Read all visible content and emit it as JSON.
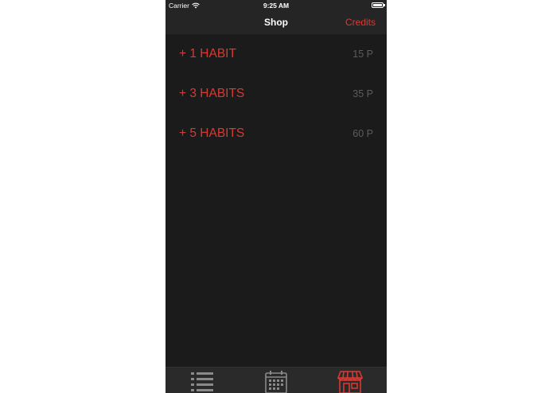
{
  "status_bar": {
    "carrier": "Carrier",
    "time": "9:25 AM",
    "battery_level": 1.0
  },
  "nav_bar": {
    "title": "Shop",
    "right_button": "Credits"
  },
  "shop_items": [
    {
      "label": "+ 1 HABIT",
      "price": "15 P"
    },
    {
      "label": "+ 3 HABITS",
      "price": "35 P"
    },
    {
      "label": "+ 5 HABITS",
      "price": "60 P"
    }
  ],
  "tab_bar": {
    "tabs": [
      {
        "icon": "list-icon",
        "selected": false
      },
      {
        "icon": "calendar-icon",
        "selected": false
      },
      {
        "icon": "shop-icon",
        "selected": true
      }
    ]
  },
  "colors": {
    "accent": "#d83a33",
    "background": "#1b1b1b",
    "bar": "#252525",
    "price": "#5c5c5c",
    "inactive_icon": "#8a8a8a"
  }
}
